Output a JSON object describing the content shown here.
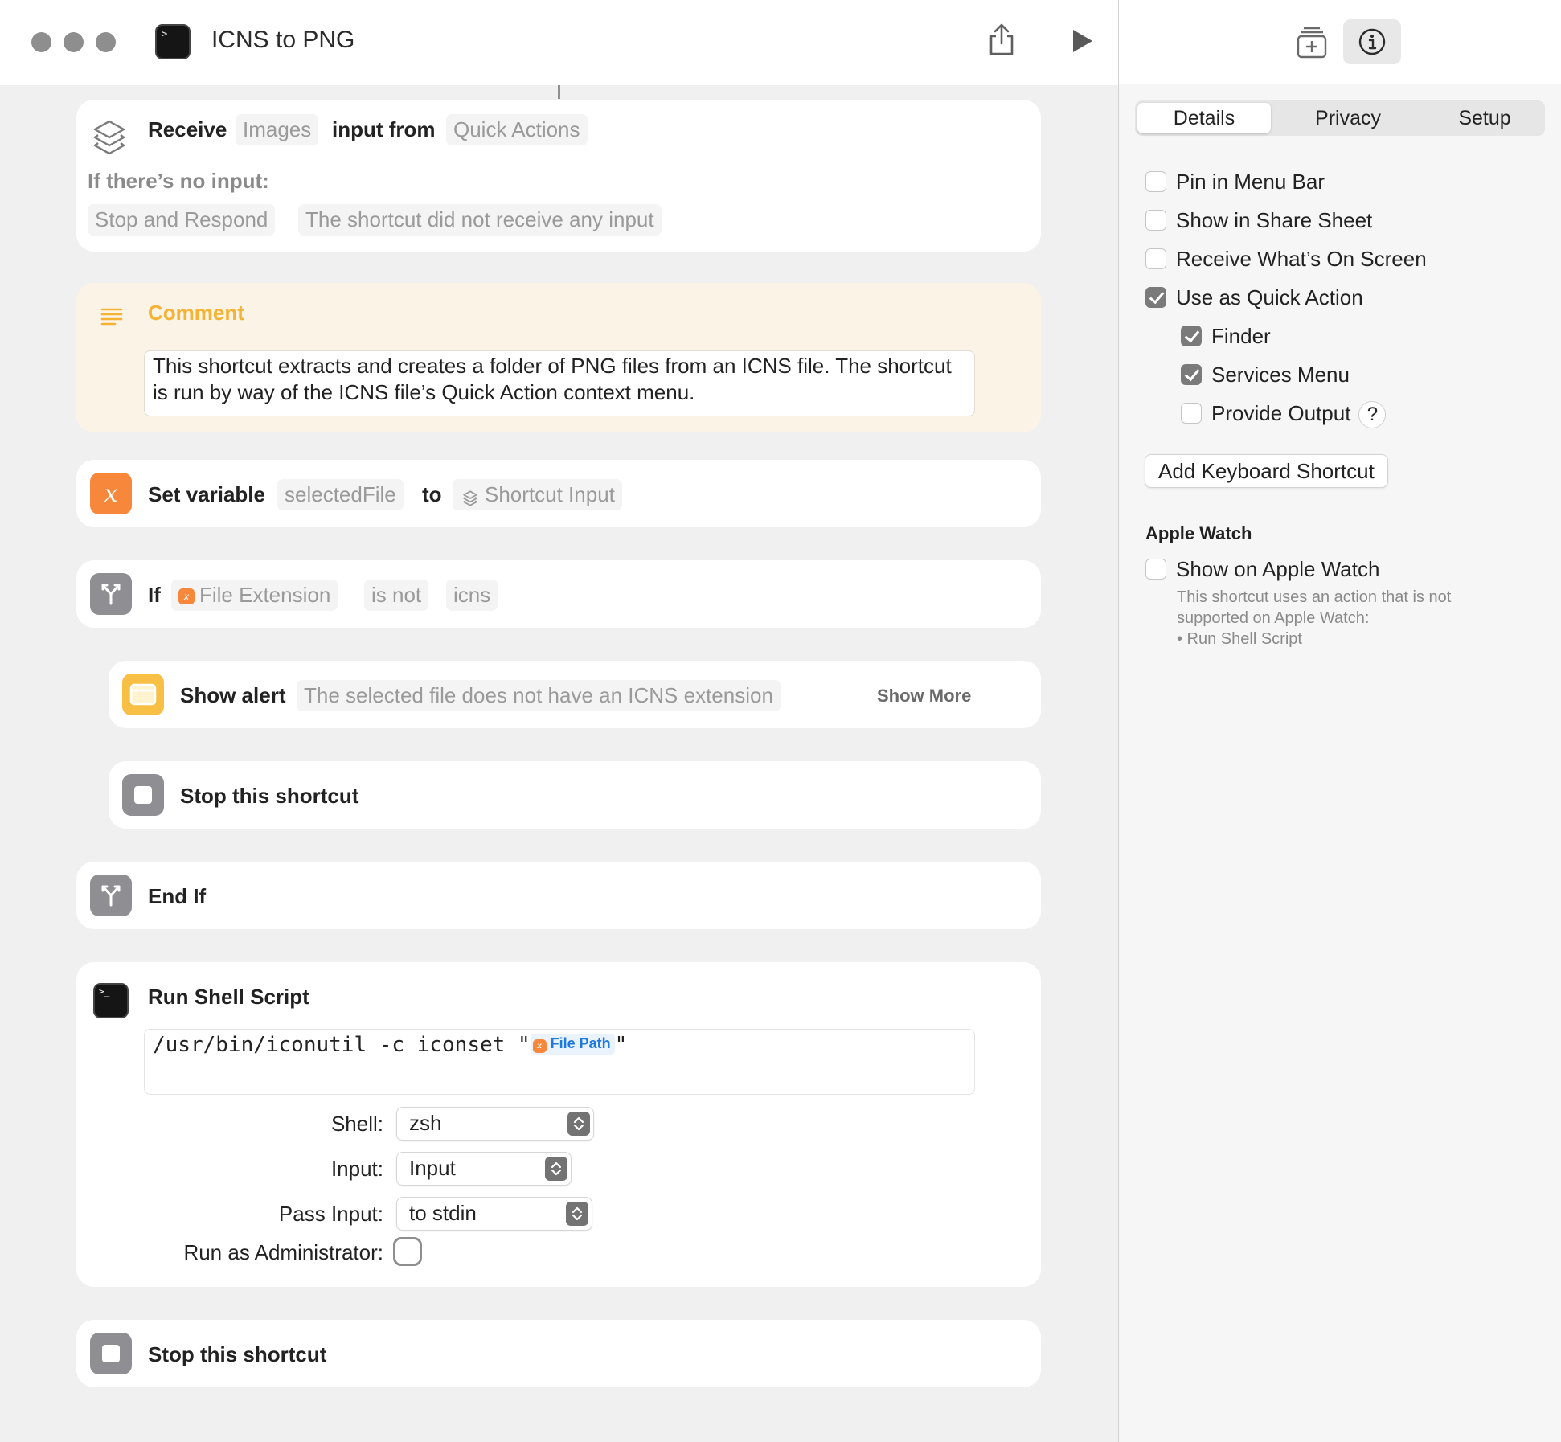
{
  "window": {
    "title": "ICNS to PNG"
  },
  "actions": {
    "receive": {
      "verb": "Receive",
      "type_token": "Images",
      "mid_text": "input from",
      "source_token": "Quick Actions",
      "no_input_label": "If there’s no input:",
      "fallback_token": "Stop and Respond",
      "response_token": "The shortcut did not receive any input"
    },
    "comment": {
      "title": "Comment",
      "text": "This shortcut extracts and creates a folder of PNG files from an ICNS file. The shortcut is run by way of the ICNS file’s Quick Action context menu."
    },
    "set_variable": {
      "title": "Set variable",
      "name_token": "selectedFile",
      "to_text": "to",
      "value_token": "Shortcut Input"
    },
    "if": {
      "title": "If",
      "subject_token": "File Extension",
      "condition_token": "is not",
      "value_token": "icns"
    },
    "show_alert": {
      "title": "Show alert",
      "message_token": "The selected file does not have an ICNS extension",
      "show_more": "Show More"
    },
    "stop_inner": {
      "title": "Stop this shortcut"
    },
    "end_if": {
      "title": "End If"
    },
    "shell": {
      "title": "Run Shell Script",
      "script_prefix": "/usr/bin/iconutil -c iconset \"",
      "script_var": "File Path",
      "script_suffix": "\"",
      "shell_label": "Shell:",
      "shell_value": "zsh",
      "input_label": "Input:",
      "input_value": "Input",
      "pass_label": "Pass Input:",
      "pass_value": "to stdin",
      "admin_label": "Run as Administrator:",
      "admin_checked": false
    },
    "stop_final": {
      "title": "Stop this shortcut"
    }
  },
  "panel": {
    "tabs": [
      "Details",
      "Privacy",
      "Setup"
    ],
    "active_tab": "Details",
    "options": [
      {
        "label": "Pin in Menu Bar",
        "checked": false
      },
      {
        "label": "Show in Share Sheet",
        "checked": false
      },
      {
        "label": "Receive What’s On Screen",
        "checked": false
      },
      {
        "label": "Use as Quick Action",
        "checked": true
      },
      {
        "label": "Finder",
        "checked": true
      },
      {
        "label": "Services Menu",
        "checked": true
      },
      {
        "label": "Provide Output",
        "checked": false
      }
    ],
    "help_glyph": "?",
    "keyboard_button": "Add Keyboard Shortcut",
    "watch_section": "Apple Watch",
    "watch_option": {
      "label": "Show on Apple Watch",
      "checked": false
    },
    "watch_note_line1": "This shortcut uses an action that is not",
    "watch_note_line2": "supported on Apple Watch:",
    "watch_note_line3": "• Run Shell Script"
  },
  "icons": {
    "receive": "quick-actions-icon",
    "comment": "comment-lines-icon",
    "variable": "variable-x-icon",
    "if": "branch-icon",
    "alert": "alert-window-icon",
    "stop": "stop-icon",
    "shell": "terminal-icon"
  },
  "colors": {
    "accent_orange": "#f6873b",
    "comment_yellow": "#f5b335",
    "alert_yellow": "#f7c044",
    "token_gray": "#9a9a9a",
    "link_blue": "#1f7ae0"
  }
}
